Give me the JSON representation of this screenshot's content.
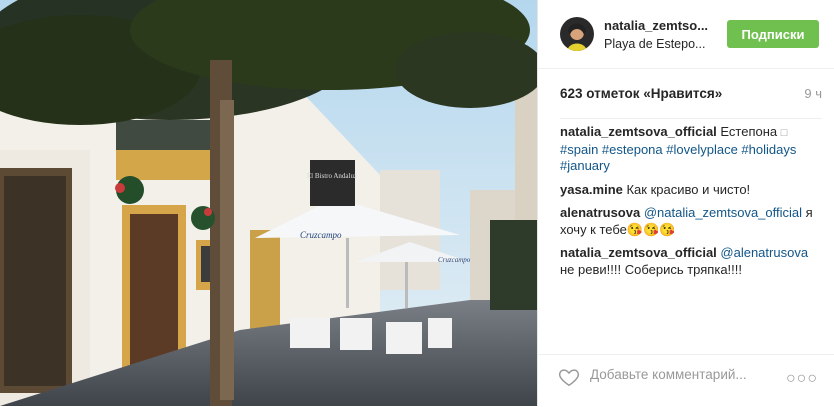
{
  "post": {
    "username": "natalia_zemtso...",
    "location": "Playa de Estepo...",
    "follow_label": "Подписки",
    "likes": "623 отметок «Нравится»",
    "time": "9 ч"
  },
  "comments": [
    {
      "user": "natalia_zemtsova_official",
      "text": " Естепона ",
      "glyph": "□",
      "hashtags": "#spain #estepona #lovelyplace #holidays #january"
    },
    {
      "user": "yasa.mine",
      "text": " Как красиво и чисто!"
    },
    {
      "user": "alenatrusova",
      "mention": " @natalia_zemtsova_official",
      "text": " я хочу к тебе😘😘😘"
    },
    {
      "user": "natalia_zemtsova_official",
      "mention": " @alenatrusova",
      "text": " не реви!!!! Соберись тряпка!!!!"
    }
  ],
  "photo_text": {
    "sign": "El Bistro Andaluz",
    "umbrella": "Cruzcampo"
  },
  "footer": {
    "add_comment_placeholder": "Добавьте комментарий...",
    "more": "○○○"
  },
  "colors": {
    "follow": "#70c050",
    "link": "#125688",
    "muted": "#999999"
  },
  "icons": [
    "heart-icon",
    "more-options-icon"
  ]
}
